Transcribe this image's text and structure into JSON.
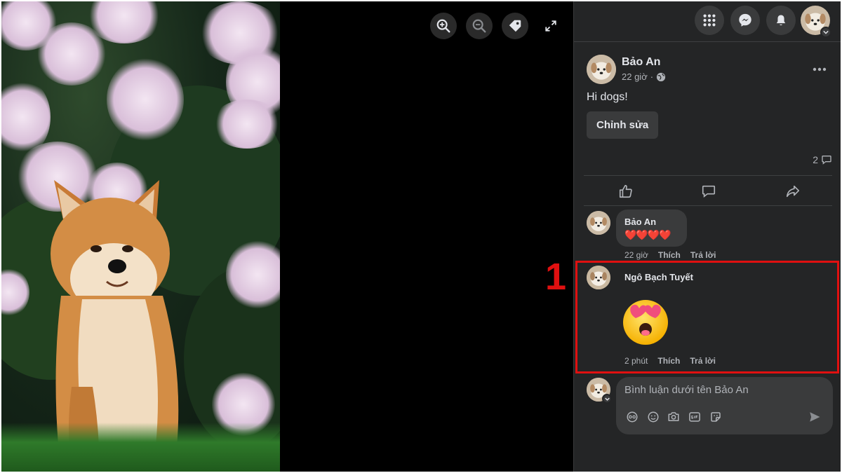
{
  "photo_viewer": {
    "toolbar": [
      {
        "name": "zoom-in-icon"
      },
      {
        "name": "zoom-out-icon"
      },
      {
        "name": "tag-icon"
      },
      {
        "name": "fullscreen-icon"
      }
    ]
  },
  "topbar": {
    "menu_icon": "grid-menu-icon",
    "messenger_icon": "messenger-icon",
    "notifications_icon": "bell-icon"
  },
  "post": {
    "author": "Bảo An",
    "time": "22 giờ",
    "separator": "·",
    "privacy_icon": "globe-icon",
    "text": "Hi dogs!",
    "edit_label": "Chỉnh sửa",
    "comment_count": "2"
  },
  "comments": [
    {
      "author": "Bảo An",
      "content": "❤️❤️❤️❤️",
      "time": "22 giờ",
      "like_label": "Thích",
      "reply_label": "Trả lời"
    },
    {
      "author": "Ngô Bạch Tuyết",
      "sticker": "heart-eyes-emoji",
      "time": "2 phút",
      "like_label": "Thích",
      "reply_label": "Trả lời"
    }
  ],
  "annotation": {
    "number": "1",
    "color": "#e01010"
  },
  "composer": {
    "placeholder": "Bình luận dưới tên Bảo An"
  },
  "colors": {
    "panel_bg": "#242526",
    "bubble_bg": "#3a3b3c",
    "primary_text": "#e4e6eb",
    "secondary_text": "#b0b3b8"
  }
}
